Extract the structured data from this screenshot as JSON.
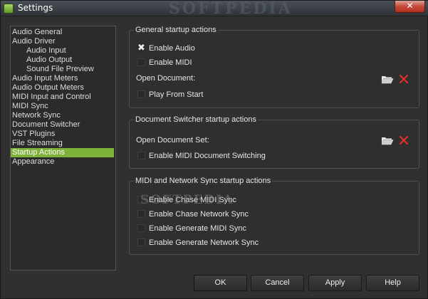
{
  "window": {
    "title": "Settings",
    "close_glyph": "✕",
    "watermark": "SOFTPEDIA"
  },
  "sidebar": {
    "items": [
      {
        "label": "Audio General"
      },
      {
        "label": "Audio Driver"
      },
      {
        "label": "Audio Input"
      },
      {
        "label": "Audio Output"
      },
      {
        "label": "Sound File Preview"
      },
      {
        "label": "Audio Input Meters"
      },
      {
        "label": "Audio Output Meters"
      },
      {
        "label": "MIDI Input and Control"
      },
      {
        "label": "MIDI Sync"
      },
      {
        "label": "Network Sync"
      },
      {
        "label": "Document Switcher"
      },
      {
        "label": "VST Plugins"
      },
      {
        "label": "File Streaming"
      },
      {
        "label": "Startup Actions"
      },
      {
        "label": "Appearance"
      }
    ],
    "selected": "Startup Actions"
  },
  "general": {
    "title": "General startup actions",
    "enable_audio": {
      "label": "Enable Audio",
      "checked": true
    },
    "enable_midi": {
      "label": "Enable MIDI",
      "checked": false
    },
    "open_document": {
      "label": "Open Document:"
    },
    "play_from_start": {
      "label": "Play From Start",
      "checked": false
    }
  },
  "switcher": {
    "title": "Document Switcher startup actions",
    "open_document_set": {
      "label": "Open Document Set:"
    },
    "enable_midi_switching": {
      "label": "Enable MIDI Document Switching",
      "checked": false
    }
  },
  "midi_sync": {
    "title": "MIDI and Network Sync startup actions",
    "chase_midi": {
      "label": "Enable Chase MIDI Sync",
      "checked": false
    },
    "chase_network": {
      "label": "Enable Chase Network Sync",
      "checked": false
    },
    "generate_midi": {
      "label": "Enable Generate MIDI Sync",
      "checked": false
    },
    "generate_network": {
      "label": "Enable Generate Network Sync",
      "checked": false
    }
  },
  "watermark_mid": "SOFTPEDIA",
  "footer": {
    "ok": "OK",
    "cancel": "Cancel",
    "apply": "Apply",
    "help": "Help"
  },
  "colors": {
    "selection": "#7fb23a",
    "delete_icon": "#e0302a",
    "close_button": "#c44a3a"
  },
  "icons": {
    "checkmark": "✖"
  }
}
